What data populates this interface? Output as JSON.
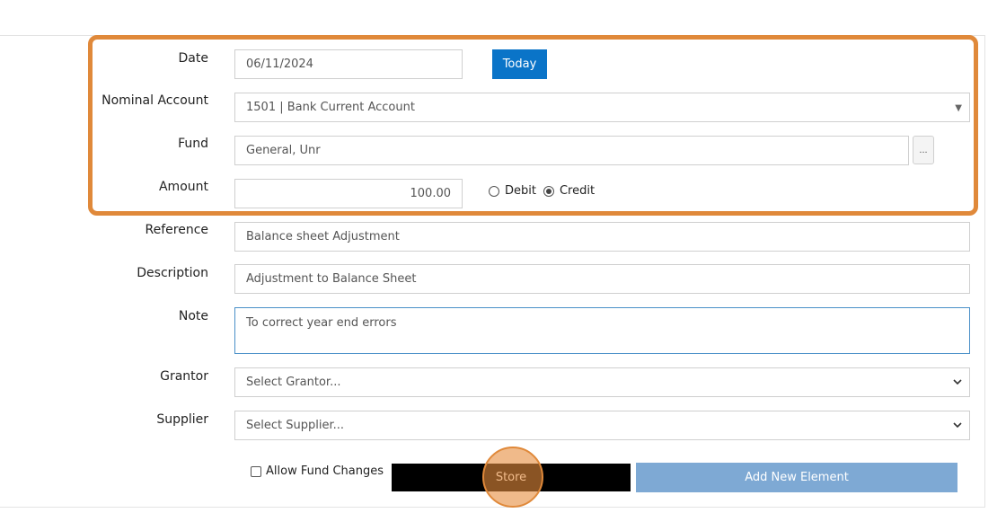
{
  "form": {
    "date": {
      "label": "Date",
      "value": "06/11/2024",
      "today_button": "Today"
    },
    "nominal_account": {
      "label": "Nominal Account",
      "value": "1501 | Bank Current Account"
    },
    "fund": {
      "label": "Fund",
      "value": "General, Unr",
      "picker_button": "..."
    },
    "amount": {
      "label": "Amount",
      "value": "100.00",
      "debit_label": "Debit",
      "credit_label": "Credit",
      "selected": "Credit"
    },
    "reference": {
      "label": "Reference",
      "value": "Balance sheet Adjustment"
    },
    "description": {
      "label": "Description",
      "value": "Adjustment to Balance Sheet"
    },
    "note": {
      "label": "Note",
      "value": "To correct year end errors"
    },
    "grantor": {
      "label": "Grantor",
      "placeholder": "Select Grantor..."
    },
    "supplier": {
      "label": "Supplier",
      "placeholder": "Select Supplier..."
    }
  },
  "actions": {
    "allow_fund_changes": "Allow Fund Changes",
    "store": "Store",
    "add_new_element": "Add New Element"
  },
  "colors": {
    "primary": "#0a74c8",
    "highlight": "#e0893a",
    "add_button": "#7ea9d4"
  }
}
